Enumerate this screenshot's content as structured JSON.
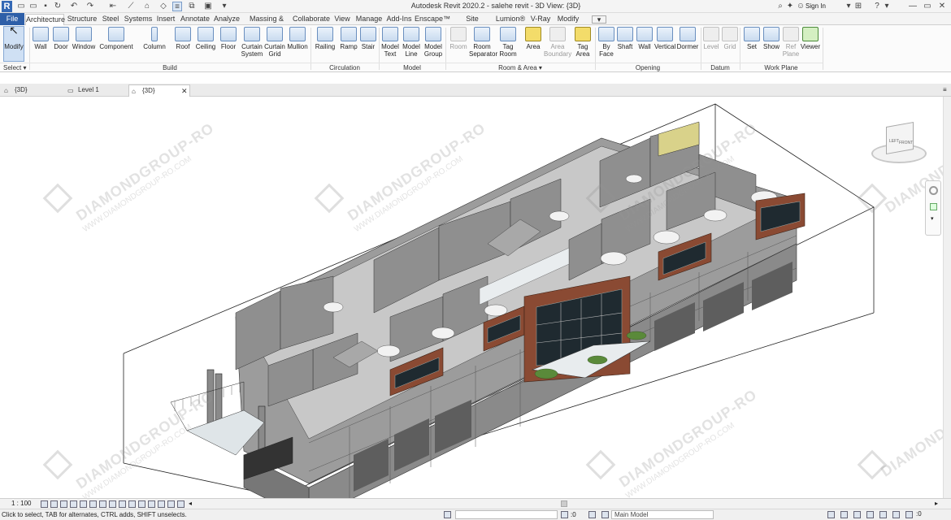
{
  "title_bar": {
    "window_title": "Autodesk Revit 2020.2 - salehe revit - 3D View: {3D}",
    "sign_in": "Sign In"
  },
  "ribbon_tabs": [
    "File",
    "Architecture",
    "Structure",
    "Steel",
    "Systems",
    "Insert",
    "Annotate",
    "Analyze",
    "Massing & Site",
    "Collaborate",
    "View",
    "Manage",
    "Add-Ins",
    "Enscape™",
    "Site Designer",
    "Lumion®",
    "V-Ray",
    "Modify"
  ],
  "active_tab": "Architecture",
  "ribbon": {
    "select": {
      "modify": "Modify",
      "label": "Select ▾"
    },
    "build": {
      "label": "Build",
      "wall": "Wall",
      "door": "Door",
      "window": "Window",
      "component": "Component",
      "column": "Column",
      "roof": "Roof",
      "ceiling": "Ceiling",
      "floor": "Floor",
      "curtain_system": "Curtain System",
      "curtain_grid": "Curtain Grid",
      "mullion": "Mullion"
    },
    "circulation": {
      "label": "Circulation",
      "railing": "Railing",
      "ramp": "Ramp",
      "stair": "Stair"
    },
    "model": {
      "label": "Model",
      "model_text": "Model Text",
      "model_line": "Model Line",
      "model_group": "Model Group"
    },
    "room_area": {
      "label": "Room & Area ▾",
      "room": "Room",
      "room_separator": "Room Separator",
      "tag_room": "Tag Room",
      "area": "Area",
      "area_boundary": "Area Boundary",
      "tag_area": "Tag Area"
    },
    "opening": {
      "label": "Opening",
      "by_face": "By Face",
      "shaft": "Shaft",
      "wall": "Wall",
      "vertical": "Vertical",
      "dormer": "Dormer"
    },
    "datum": {
      "label": "Datum",
      "level": "Level",
      "grid": "Grid"
    },
    "work_plane": {
      "label": "Work Plane",
      "set": "Set",
      "show": "Show",
      "ref_plane": "Ref Plane",
      "viewer": "Viewer"
    }
  },
  "view_tabs": [
    {
      "label": "{3D}",
      "active": false
    },
    {
      "label": "Level 1",
      "active": false
    },
    {
      "label": "{3D}",
      "active": true
    }
  ],
  "view_cube": {
    "left": "LEFT",
    "front": "FRONT"
  },
  "watermark": {
    "name": "DIAMONDGROUP-RO",
    "url": "WWW.DIAMONDGROUP-RO.COM"
  },
  "view_control_bar": {
    "scale": "1 : 100"
  },
  "status_bar": {
    "message": "Click to select, TAB for alternates, CTRL adds, SHIFT unselects.",
    "count": ":0",
    "workset_model": "Main Model"
  },
  "colors": {
    "file_tab": "#2e5fa8",
    "brick": "#8a4a33",
    "wall_grey": "#8d8d8d",
    "floor_grey": "#c4c4c4"
  }
}
